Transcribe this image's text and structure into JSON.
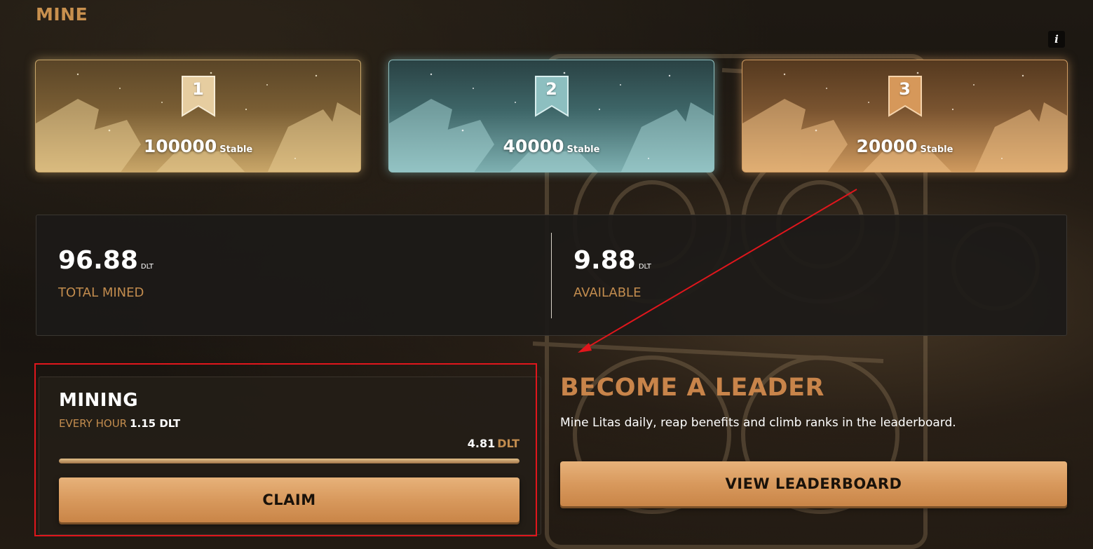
{
  "page": {
    "title": "MINE",
    "info_icon": "i"
  },
  "prizes": [
    {
      "rank": "1",
      "amount": "100000",
      "unit": "Stable",
      "tier": "gold"
    },
    {
      "rank": "2",
      "amount": "40000",
      "unit": "Stable",
      "tier": "silver"
    },
    {
      "rank": "3",
      "amount": "20000",
      "unit": "Stable",
      "tier": "bronze"
    }
  ],
  "stats": {
    "total_mined": {
      "value": "96.88",
      "unit": "DLT",
      "label": "TOTAL MINED"
    },
    "available": {
      "value": "9.88",
      "unit": "DLT",
      "label": "AVAILABLE"
    }
  },
  "mining": {
    "title": "MINING",
    "rate_label": "EVERY HOUR",
    "rate_value": "1.15 DLT",
    "current_value": "4.81",
    "current_unit": "DLT",
    "progress_fraction": 1.0,
    "claim_label": "CLAIM"
  },
  "leader": {
    "title": "BECOME A LEADER",
    "description": "Mine Litas daily, reap benefits and climb ranks in the leaderboard.",
    "button_label": "VIEW LEADERBOARD"
  },
  "colors": {
    "accent": "#c8904e",
    "gold": "#c9a668",
    "silver": "#7eb0b1",
    "bronze": "#cf9a5e",
    "annotation": "#e0161c"
  }
}
